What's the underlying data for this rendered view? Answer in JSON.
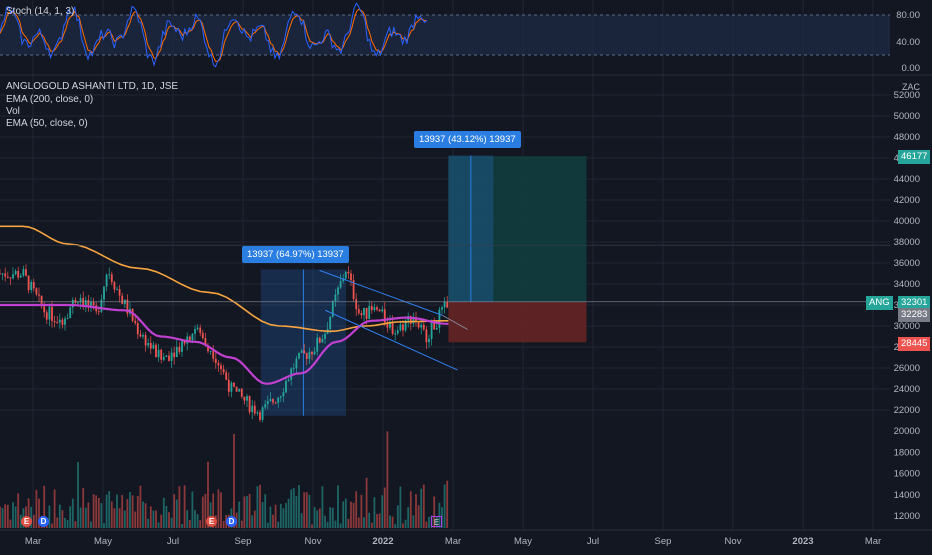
{
  "stoch": {
    "label": "Stoch (14, 1, 3)",
    "ticks": [
      "80.00",
      "40.00",
      "0.00"
    ],
    "k_color": "#2962ff",
    "d_color": "#ff6d00",
    "band_color": "#1e2a44"
  },
  "main": {
    "symbol_title": "ANGLOGOLD ASHANTI LTD, 1D, JSE",
    "legend_ema200": "EMA (200, close, 0)",
    "legend_vol": "Vol",
    "legend_ema50": "EMA (50, close, 0)",
    "currency": "ZAC"
  },
  "price_axis": {
    "ticks": [
      "52000",
      "50000",
      "48000",
      "46000",
      "44000",
      "42000",
      "40000",
      "38000",
      "36000",
      "34000",
      "32000",
      "30000",
      "28000",
      "26000",
      "24000",
      "22000"
    ],
    "badges": {
      "target": "46177",
      "symbol": "ANG",
      "last": "32301",
      "ema": "32283",
      "stop": "28445"
    }
  },
  "volume_axis": {
    "ticks": [
      "20000",
      "18000",
      "16000",
      "14000",
      "12000"
    ]
  },
  "time_axis": {
    "labels": [
      "Mar",
      "May",
      "Jul",
      "Sep",
      "Nov",
      "2022",
      "Mar",
      "May",
      "Jul",
      "Sep",
      "Nov",
      "2023",
      "Mar"
    ]
  },
  "measurements": {
    "first": "13937 (64.97%) 13937",
    "second": "13937 (43.12%) 13937"
  },
  "events": [
    "E",
    "D",
    "E",
    "D",
    "E"
  ],
  "colors": {
    "up": "#26a69a",
    "down": "#ef5350",
    "ema200": "#f7a440",
    "ema50": "#c040d0",
    "measure": "#2a7de1",
    "profit_zone": "#124040",
    "loss_zone": "#6b2424",
    "channel": "#2f80ed"
  },
  "chart_data": {
    "type": "candlestick",
    "title": "ANGLOGOLD ASHANTI LTD, 1D, JSE",
    "currency": "ZAC",
    "x_range": [
      "2021-02",
      "2023-03"
    ],
    "ylim": [
      21000,
      52500
    ],
    "price_path": [
      [
        "2021-02-20",
        35000
      ],
      [
        "2021-03-10",
        31500
      ],
      [
        "2021-03-25",
        30500
      ],
      [
        "2021-04-10",
        33000
      ],
      [
        "2021-04-25",
        31000
      ],
      [
        "2021-05-05",
        35500
      ],
      [
        "2021-05-15",
        33000
      ],
      [
        "2021-06-01",
        29500
      ],
      [
        "2021-06-20",
        26800
      ],
      [
        "2021-07-05",
        28000
      ],
      [
        "2021-07-20",
        29800
      ],
      [
        "2021-08-05",
        27500
      ],
      [
        "2021-08-20",
        24000
      ],
      [
        "2021-09-05",
        22500
      ],
      [
        "2021-09-15",
        21700
      ],
      [
        "2021-10-01",
        23500
      ],
      [
        "2021-10-15",
        26500
      ],
      [
        "2021-11-01",
        28000
      ],
      [
        "2021-11-10",
        29500
      ],
      [
        "2021-11-20",
        33000
      ],
      [
        "2021-11-28",
        35500
      ],
      [
        "2021-12-10",
        31000
      ],
      [
        "2021-12-25",
        31500
      ],
      [
        "2022-01-10",
        29500
      ],
      [
        "2022-01-25",
        31000
      ],
      [
        "2022-02-05",
        29000
      ],
      [
        "2022-02-15",
        30500
      ],
      [
        "2022-02-25",
        32301
      ]
    ],
    "ema50_path": [
      [
        "2021-02-20",
        32000
      ],
      [
        "2021-04-01",
        32000
      ],
      [
        "2021-05-20",
        31500
      ],
      [
        "2021-06-20",
        29000
      ],
      [
        "2021-07-20",
        28500
      ],
      [
        "2021-08-20",
        27000
      ],
      [
        "2021-09-20",
        24500
      ],
      [
        "2021-10-20",
        25500
      ],
      [
        "2021-11-20",
        28500
      ],
      [
        "2021-12-20",
        30500
      ],
      [
        "2022-01-20",
        30800
      ],
      [
        "2022-02-25",
        30200
      ]
    ],
    "ema200_path": [
      [
        "2021-02-20",
        39500
      ],
      [
        "2021-04-01",
        37800
      ],
      [
        "2021-06-01",
        35500
      ],
      [
        "2021-08-01",
        33200
      ],
      [
        "2021-10-01",
        30000
      ],
      [
        "2021-11-15",
        29500
      ],
      [
        "2021-12-15",
        30000
      ],
      [
        "2022-01-15",
        30400
      ],
      [
        "2022-02-25",
        30500
      ]
    ],
    "long_position": {
      "entry": 32301,
      "target": 46177,
      "stop": 28445,
      "start": "2022-02-25",
      "end": "2022-06-25"
    },
    "measure_ranges": [
      {
        "label": "13937 (64.97%) 13937",
        "from": 21450,
        "to": 35387,
        "start": "2021-09-15",
        "end": "2021-11-28"
      },
      {
        "label": "13937 (43.12%) 13937",
        "from": 32301,
        "to": 46238,
        "start": "2022-02-25",
        "end": "2022-04-05"
      }
    ],
    "channel": {
      "upper": [
        [
          "2021-11-05",
          35300
        ],
        [
          "2022-02-20",
          31000
        ]
      ],
      "lower": [
        [
          "2021-11-10",
          31500
        ],
        [
          "2022-03-05",
          25800
        ]
      ]
    },
    "volume_ylim": [
      11000,
      21500
    ],
    "stoch_ticks": [
      80,
      40,
      0
    ]
  }
}
